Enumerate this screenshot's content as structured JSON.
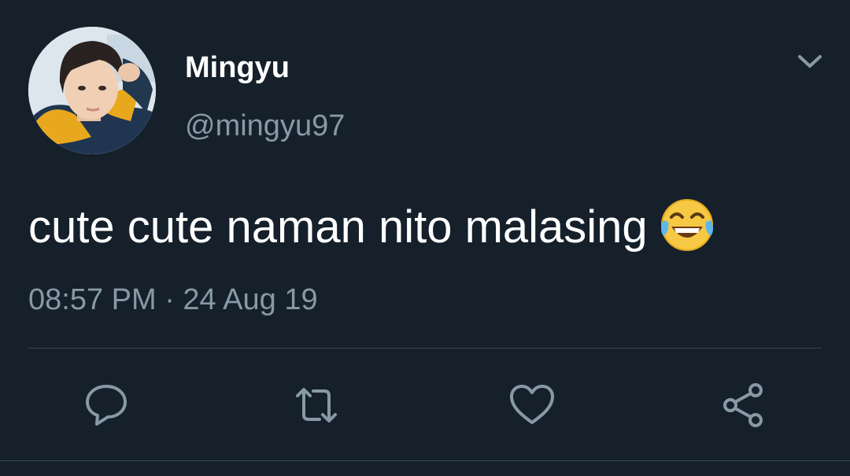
{
  "author": {
    "display_name": "Mingyu",
    "handle": "@mingyu97"
  },
  "tweet": {
    "text": "cute cute naman nito malasing",
    "emoji": "face-with-tears-of-joy",
    "timestamp": "08:57 PM · 24 Aug 19"
  },
  "actions": [
    "reply-icon",
    "retweet-icon",
    "like-icon",
    "share-icon"
  ],
  "colors": {
    "background": "#15202b",
    "primary_text": "#ffffff",
    "secondary_text": "#8899a6",
    "divider": "#38444d"
  }
}
